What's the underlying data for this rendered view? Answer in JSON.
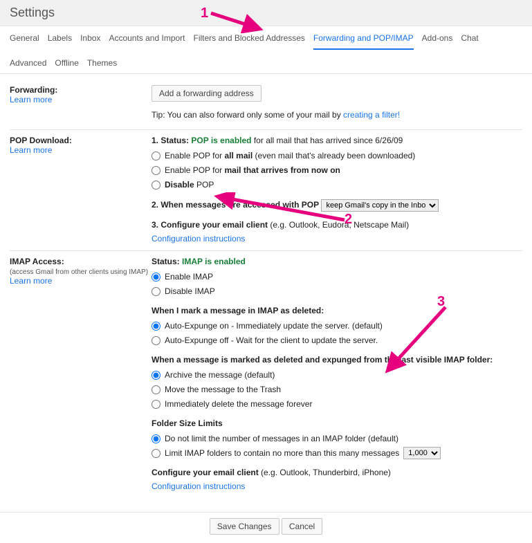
{
  "header": {
    "title": "Settings"
  },
  "tabs": [
    {
      "label": "General"
    },
    {
      "label": "Labels"
    },
    {
      "label": "Inbox"
    },
    {
      "label": "Accounts and Import"
    },
    {
      "label": "Filters and Blocked Addresses"
    },
    {
      "label": "Forwarding and POP/IMAP",
      "active": true
    },
    {
      "label": "Add-ons"
    },
    {
      "label": "Chat"
    },
    {
      "label": "Advanced"
    },
    {
      "label": "Offline"
    },
    {
      "label": "Themes"
    }
  ],
  "common": {
    "learn_more": "Learn more"
  },
  "forwarding": {
    "title": "Forwarding:",
    "add_btn": "Add a forwarding address",
    "tip_pre": "Tip: You can also forward only some of your mail by ",
    "tip_link": "creating a filter!"
  },
  "pop": {
    "title": "POP Download:",
    "status_label": "1. Status: ",
    "status_value": "POP is enabled",
    "status_suffix": " for all mail that has arrived since 6/26/09",
    "opt_all_pre": "Enable POP for ",
    "opt_all_b": "all mail",
    "opt_all_suffix": " (even mail that's already been downloaded)",
    "opt_now_pre": "Enable POP for ",
    "opt_now_b": "mail that arrives from now on",
    "opt_disable_b": "Disable",
    "opt_disable_suffix": " POP",
    "access_label": "2. When messages are accessed with POP",
    "access_select": "keep Gmail's copy in the Inbox",
    "configure_label": "3. Configure your email client ",
    "configure_suffix": "(e.g. Outlook, Eudora, Netscape Mail)",
    "config_link": "Configuration instructions"
  },
  "imap": {
    "title": "IMAP Access:",
    "subtitle": "(access Gmail from other clients using IMAP)",
    "status_label": "Status: ",
    "status_value": "IMAP is enabled",
    "opt_enable": "Enable IMAP",
    "opt_disable": "Disable IMAP",
    "deleted_heading": "When I mark a message in IMAP as deleted:",
    "expunge_on": "Auto-Expunge on - Immediately update the server. (default)",
    "expunge_off": "Auto-Expunge off - Wait for the client to update the server.",
    "expunged_heading": "When a message is marked as deleted and expunged from the last visible IMAP folder:",
    "exp_archive": "Archive the message (default)",
    "exp_trash": "Move the message to the Trash",
    "exp_delete": "Immediately delete the message forever",
    "folder_heading": "Folder Size Limits",
    "folder_nolimit": "Do not limit the number of messages in an IMAP folder (default)",
    "folder_limit_pre": "Limit IMAP folders to contain no more than this many messages",
    "folder_limit_select": "1,000",
    "configure_label": "Configure your email client ",
    "configure_suffix": "(e.g. Outlook, Thunderbird, iPhone)",
    "config_link": "Configuration instructions"
  },
  "footer": {
    "save": "Save Changes",
    "cancel": "Cancel"
  },
  "anno": {
    "n1": "1",
    "n2": "2",
    "n3": "3"
  }
}
